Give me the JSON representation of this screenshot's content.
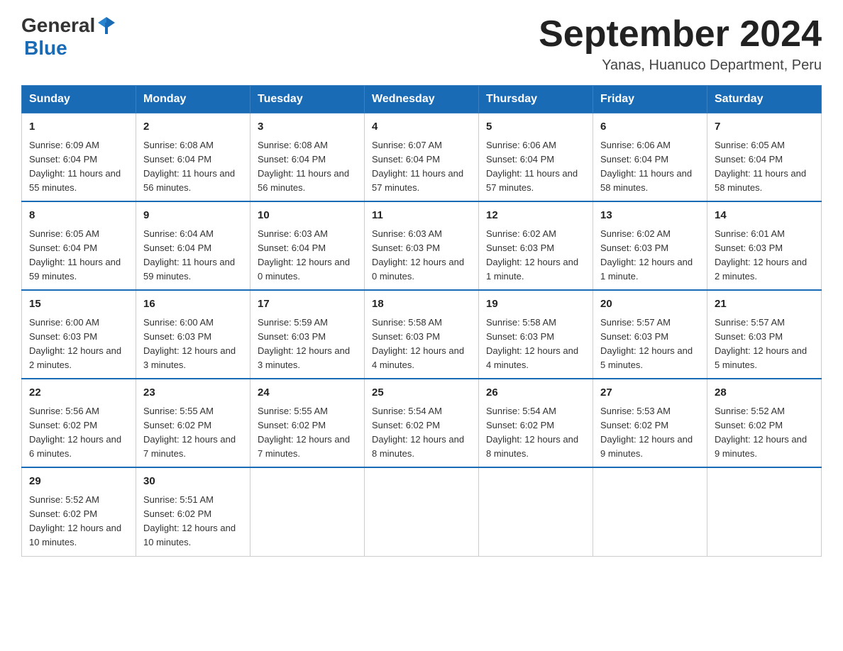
{
  "header": {
    "logo_general": "General",
    "logo_blue": "Blue",
    "month_title": "September 2024",
    "location": "Yanas, Huanuco Department, Peru"
  },
  "weekdays": [
    "Sunday",
    "Monday",
    "Tuesday",
    "Wednesday",
    "Thursday",
    "Friday",
    "Saturday"
  ],
  "weeks": [
    [
      {
        "day": "1",
        "sunrise": "6:09 AM",
        "sunset": "6:04 PM",
        "daylight": "11 hours and 55 minutes."
      },
      {
        "day": "2",
        "sunrise": "6:08 AM",
        "sunset": "6:04 PM",
        "daylight": "11 hours and 56 minutes."
      },
      {
        "day": "3",
        "sunrise": "6:08 AM",
        "sunset": "6:04 PM",
        "daylight": "11 hours and 56 minutes."
      },
      {
        "day": "4",
        "sunrise": "6:07 AM",
        "sunset": "6:04 PM",
        "daylight": "11 hours and 57 minutes."
      },
      {
        "day": "5",
        "sunrise": "6:06 AM",
        "sunset": "6:04 PM",
        "daylight": "11 hours and 57 minutes."
      },
      {
        "day": "6",
        "sunrise": "6:06 AM",
        "sunset": "6:04 PM",
        "daylight": "11 hours and 58 minutes."
      },
      {
        "day": "7",
        "sunrise": "6:05 AM",
        "sunset": "6:04 PM",
        "daylight": "11 hours and 58 minutes."
      }
    ],
    [
      {
        "day": "8",
        "sunrise": "6:05 AM",
        "sunset": "6:04 PM",
        "daylight": "11 hours and 59 minutes."
      },
      {
        "day": "9",
        "sunrise": "6:04 AM",
        "sunset": "6:04 PM",
        "daylight": "11 hours and 59 minutes."
      },
      {
        "day": "10",
        "sunrise": "6:03 AM",
        "sunset": "6:04 PM",
        "daylight": "12 hours and 0 minutes."
      },
      {
        "day": "11",
        "sunrise": "6:03 AM",
        "sunset": "6:03 PM",
        "daylight": "12 hours and 0 minutes."
      },
      {
        "day": "12",
        "sunrise": "6:02 AM",
        "sunset": "6:03 PM",
        "daylight": "12 hours and 1 minute."
      },
      {
        "day": "13",
        "sunrise": "6:02 AM",
        "sunset": "6:03 PM",
        "daylight": "12 hours and 1 minute."
      },
      {
        "day": "14",
        "sunrise": "6:01 AM",
        "sunset": "6:03 PM",
        "daylight": "12 hours and 2 minutes."
      }
    ],
    [
      {
        "day": "15",
        "sunrise": "6:00 AM",
        "sunset": "6:03 PM",
        "daylight": "12 hours and 2 minutes."
      },
      {
        "day": "16",
        "sunrise": "6:00 AM",
        "sunset": "6:03 PM",
        "daylight": "12 hours and 3 minutes."
      },
      {
        "day": "17",
        "sunrise": "5:59 AM",
        "sunset": "6:03 PM",
        "daylight": "12 hours and 3 minutes."
      },
      {
        "day": "18",
        "sunrise": "5:58 AM",
        "sunset": "6:03 PM",
        "daylight": "12 hours and 4 minutes."
      },
      {
        "day": "19",
        "sunrise": "5:58 AM",
        "sunset": "6:03 PM",
        "daylight": "12 hours and 4 minutes."
      },
      {
        "day": "20",
        "sunrise": "5:57 AM",
        "sunset": "6:03 PM",
        "daylight": "12 hours and 5 minutes."
      },
      {
        "day": "21",
        "sunrise": "5:57 AM",
        "sunset": "6:03 PM",
        "daylight": "12 hours and 5 minutes."
      }
    ],
    [
      {
        "day": "22",
        "sunrise": "5:56 AM",
        "sunset": "6:02 PM",
        "daylight": "12 hours and 6 minutes."
      },
      {
        "day": "23",
        "sunrise": "5:55 AM",
        "sunset": "6:02 PM",
        "daylight": "12 hours and 7 minutes."
      },
      {
        "day": "24",
        "sunrise": "5:55 AM",
        "sunset": "6:02 PM",
        "daylight": "12 hours and 7 minutes."
      },
      {
        "day": "25",
        "sunrise": "5:54 AM",
        "sunset": "6:02 PM",
        "daylight": "12 hours and 8 minutes."
      },
      {
        "day": "26",
        "sunrise": "5:54 AM",
        "sunset": "6:02 PM",
        "daylight": "12 hours and 8 minutes."
      },
      {
        "day": "27",
        "sunrise": "5:53 AM",
        "sunset": "6:02 PM",
        "daylight": "12 hours and 9 minutes."
      },
      {
        "day": "28",
        "sunrise": "5:52 AM",
        "sunset": "6:02 PM",
        "daylight": "12 hours and 9 minutes."
      }
    ],
    [
      {
        "day": "29",
        "sunrise": "5:52 AM",
        "sunset": "6:02 PM",
        "daylight": "12 hours and 10 minutes."
      },
      {
        "day": "30",
        "sunrise": "5:51 AM",
        "sunset": "6:02 PM",
        "daylight": "12 hours and 10 minutes."
      },
      null,
      null,
      null,
      null,
      null
    ]
  ]
}
